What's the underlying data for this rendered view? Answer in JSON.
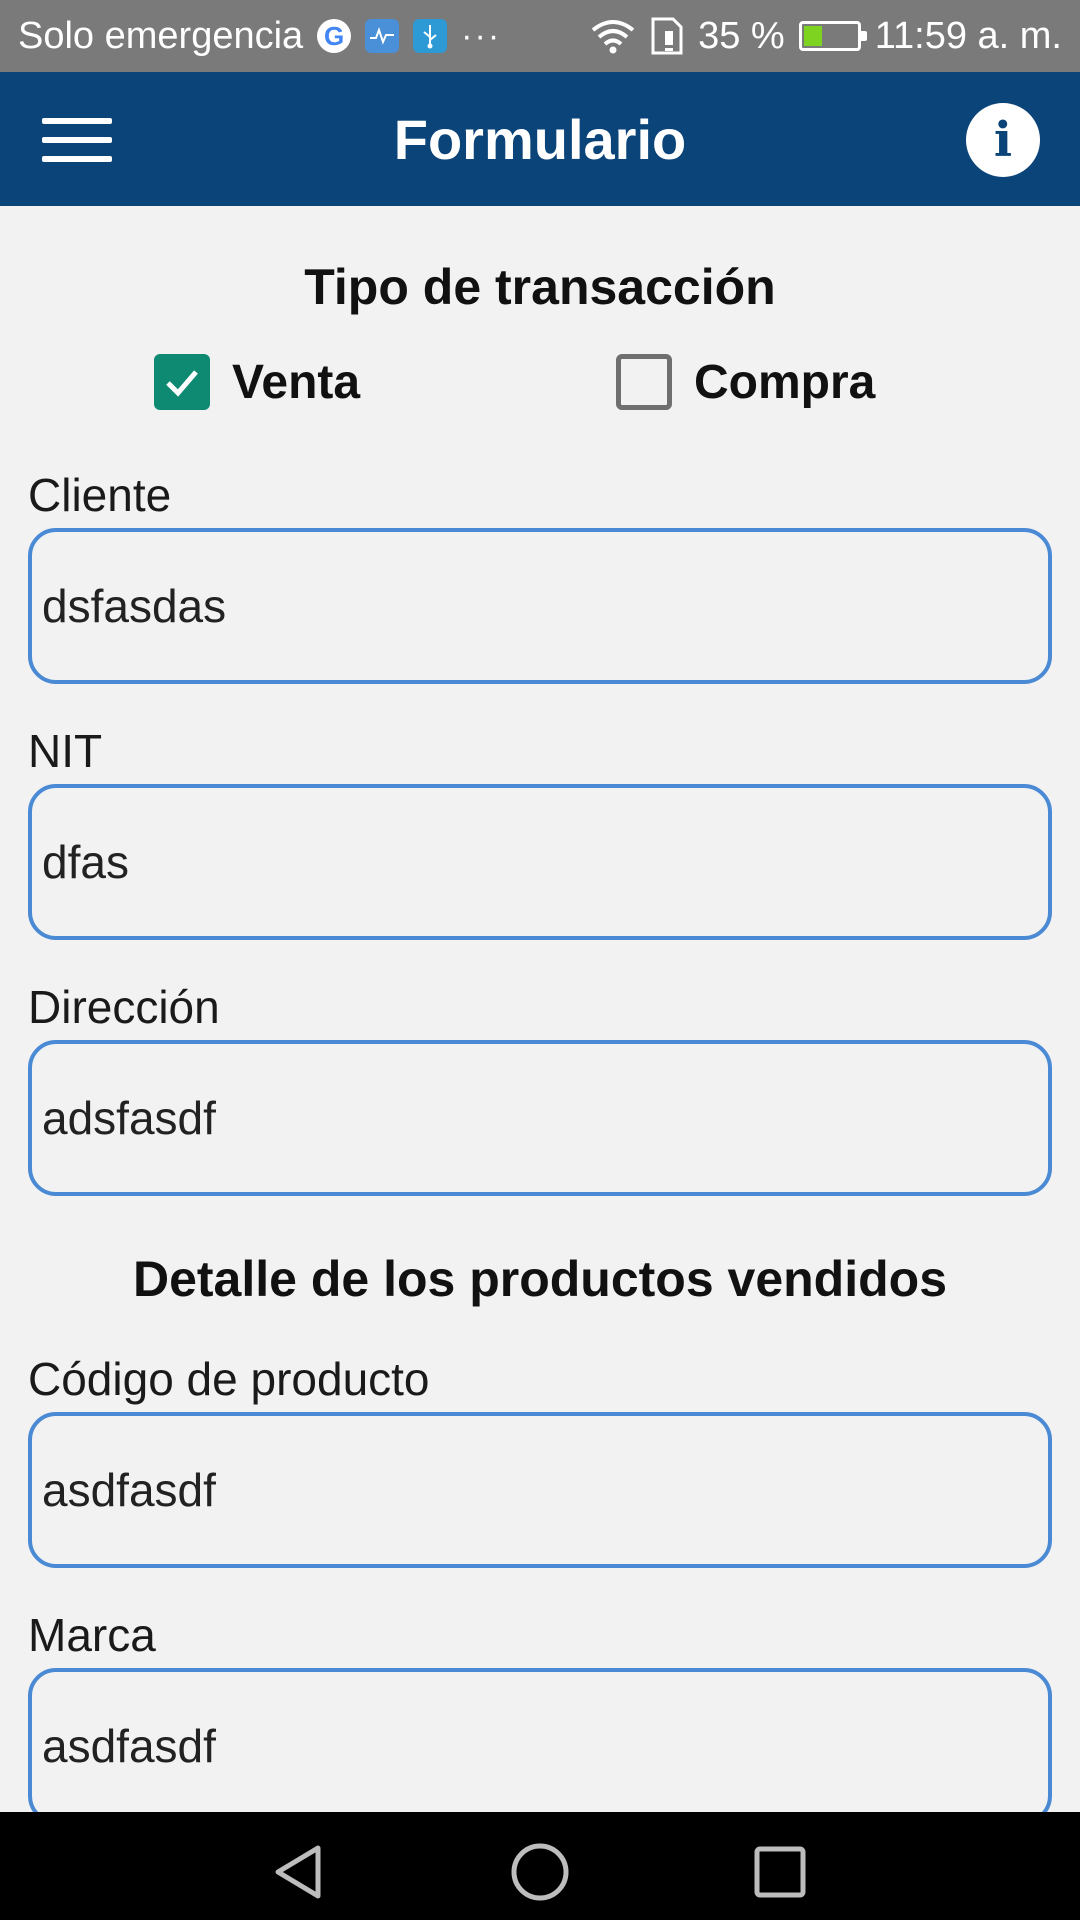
{
  "status_bar": {
    "carrier": "Solo emergencia",
    "battery_percent": "35 %",
    "battery_level": 0.35,
    "time": "11:59 a. m.",
    "notification_icons": [
      "google-icon",
      "health-app-icon",
      "usb-icon",
      "more-notifications-icon"
    ]
  },
  "app_bar": {
    "title": "Formulario",
    "info_label": "i"
  },
  "transaction": {
    "title": "Tipo de transacción",
    "options": [
      {
        "label": "Venta",
        "checked": true
      },
      {
        "label": "Compra",
        "checked": false
      }
    ]
  },
  "fields": {
    "cliente": {
      "label": "Cliente",
      "value": "dsfasdas"
    },
    "nit": {
      "label": "NIT",
      "value": "dfas"
    },
    "direccion": {
      "label": "Dirección",
      "value": "adsfasdf"
    }
  },
  "products": {
    "title": "Detalle de los productos vendidos",
    "codigo": {
      "label": "Código de producto",
      "value": "asdfasdf"
    },
    "marca": {
      "label": "Marca",
      "value": "asdfasdf"
    }
  },
  "colors": {
    "app_bar": "#0b4478",
    "checkbox_checked": "#0e8a72",
    "input_border": "#4a8ad4",
    "background": "#f2f2f2"
  }
}
